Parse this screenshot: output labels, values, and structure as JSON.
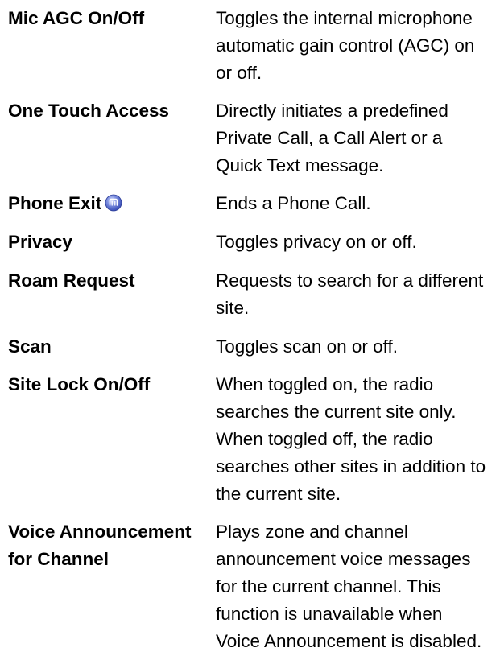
{
  "rows": [
    {
      "term": "Mic AGC On/Off",
      "description": "Toggles the internal microphone automatic gain control (AGC) on or off."
    },
    {
      "term": "One Touch Access",
      "description": "Directly initiates a predefined Private Call, a Call Alert or a Quick Text message."
    },
    {
      "term": "Phone Exit",
      "icon": "phone-exit-button-icon",
      "description": "Ends a Phone Call."
    },
    {
      "term": "Privacy",
      "description": "Toggles privacy on or off."
    },
    {
      "term": "Roam Request",
      "description": "Requests to search for a different site."
    },
    {
      "term": "Scan",
      "description": "Toggles scan on or off."
    },
    {
      "term": "Site Lock On/Off",
      "description": "When toggled on, the radio searches the current site only. When toggled off, the radio searches other sites in addition to the current site."
    },
    {
      "term": "Voice Announcement for Channel",
      "description": "Plays zone and channel announcement voice messages for the current channel. This function is unavailable when Voice Announcement is disabled."
    }
  ]
}
